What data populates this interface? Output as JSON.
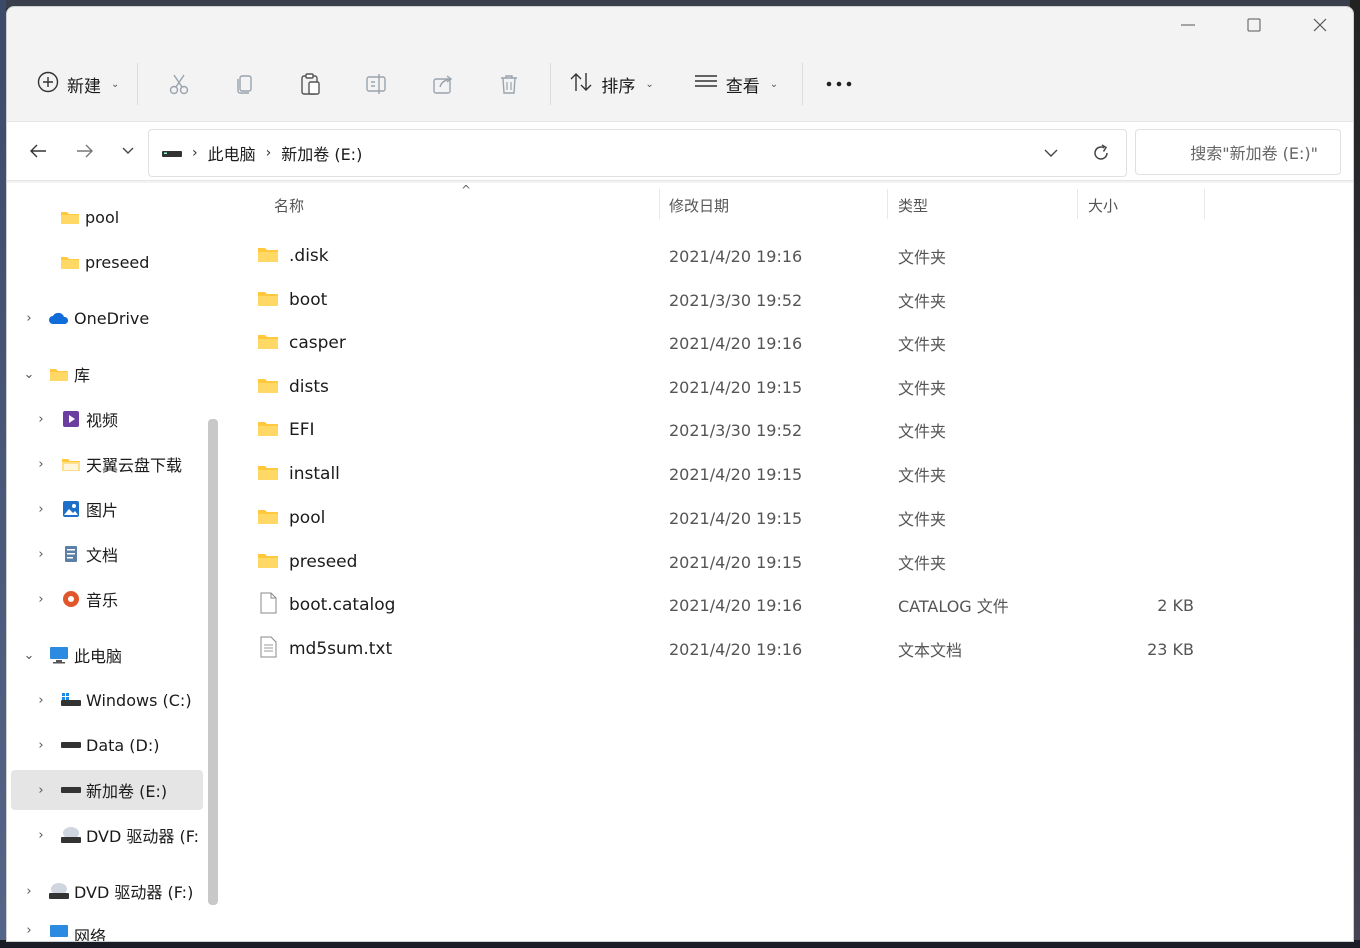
{
  "toolbar": {
    "new_label": "新建",
    "sort_label": "排序",
    "view_label": "查看",
    "icons": [
      "cut-icon",
      "copy-icon",
      "paste-icon",
      "rename-icon",
      "share-icon",
      "delete-icon"
    ],
    "more_icon": "more-icon"
  },
  "address": {
    "crumbs": [
      "此电脑",
      "新加卷 (E:)"
    ],
    "search_placeholder": "搜索\"新加卷 (E:)\""
  },
  "nav": {
    "items": [
      {
        "label": "pool"
      },
      {
        "label": "preseed"
      },
      {
        "label": "OneDrive"
      },
      {
        "label": "库"
      },
      {
        "label": "视频"
      },
      {
        "label": "天翼云盘下载"
      },
      {
        "label": "图片"
      },
      {
        "label": "文档"
      },
      {
        "label": "音乐"
      },
      {
        "label": "此电脑"
      },
      {
        "label": "Windows (C:)"
      },
      {
        "label": "Data (D:)"
      },
      {
        "label": "新加卷 (E:)"
      },
      {
        "label": "DVD 驱动器 (F:"
      },
      {
        "label": "DVD 驱动器 (F:)"
      },
      {
        "label": "网络"
      }
    ]
  },
  "columns": {
    "name": "名称",
    "date": "修改日期",
    "type": "类型",
    "size": "大小"
  },
  "files": [
    {
      "name": ".disk",
      "date": "2021/4/20 19:16",
      "type": "文件夹",
      "size": "",
      "kind": "folder"
    },
    {
      "name": "boot",
      "date": "2021/3/30 19:52",
      "type": "文件夹",
      "size": "",
      "kind": "folder"
    },
    {
      "name": "casper",
      "date": "2021/4/20 19:16",
      "type": "文件夹",
      "size": "",
      "kind": "folder"
    },
    {
      "name": "dists",
      "date": "2021/4/20 19:15",
      "type": "文件夹",
      "size": "",
      "kind": "folder"
    },
    {
      "name": "EFI",
      "date": "2021/3/30 19:52",
      "type": "文件夹",
      "size": "",
      "kind": "folder"
    },
    {
      "name": "install",
      "date": "2021/4/20 19:15",
      "type": "文件夹",
      "size": "",
      "kind": "folder"
    },
    {
      "name": "pool",
      "date": "2021/4/20 19:15",
      "type": "文件夹",
      "size": "",
      "kind": "folder"
    },
    {
      "name": "preseed",
      "date": "2021/4/20 19:15",
      "type": "文件夹",
      "size": "",
      "kind": "folder"
    },
    {
      "name": "boot.catalog",
      "date": "2021/4/20 19:16",
      "type": "CATALOG 文件",
      "size": "2 KB",
      "kind": "file"
    },
    {
      "name": "md5sum.txt",
      "date": "2021/4/20 19:16",
      "type": "文本文档",
      "size": "23 KB",
      "kind": "text"
    }
  ],
  "colors": {
    "folder": "#ffc83d",
    "accent": "#0067c0",
    "selected": "#e5e5e5"
  }
}
